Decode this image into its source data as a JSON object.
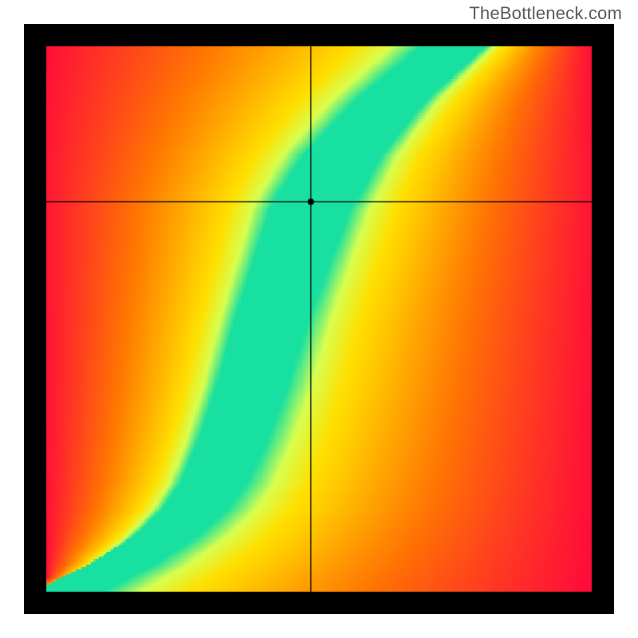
{
  "watermark": "TheBottleneck.com",
  "chart_data": {
    "type": "heatmap",
    "title": "",
    "xlabel": "",
    "ylabel": "",
    "x_range": [
      0,
      1
    ],
    "y_range": [
      0,
      1
    ],
    "crosshair": {
      "x": 0.485,
      "y": 0.715
    },
    "marker": {
      "x": 0.485,
      "y": 0.715,
      "radius": 4
    },
    "optimal_curve": {
      "description": "Green optimal-band curve through the heatmap",
      "points": [
        {
          "x": 0.0,
          "y": 0.0
        },
        {
          "x": 0.1,
          "y": 0.05
        },
        {
          "x": 0.18,
          "y": 0.1
        },
        {
          "x": 0.24,
          "y": 0.15
        },
        {
          "x": 0.28,
          "y": 0.2
        },
        {
          "x": 0.32,
          "y": 0.28
        },
        {
          "x": 0.36,
          "y": 0.38
        },
        {
          "x": 0.4,
          "y": 0.5
        },
        {
          "x": 0.44,
          "y": 0.6
        },
        {
          "x": 0.48,
          "y": 0.7
        },
        {
          "x": 0.55,
          "y": 0.8
        },
        {
          "x": 0.65,
          "y": 0.9
        },
        {
          "x": 0.78,
          "y": 1.0
        }
      ],
      "band_width": 0.045
    },
    "background_gradient": {
      "left_side": [
        "#ff003a",
        "#ff6a00",
        "#ffd400"
      ],
      "right_side": [
        "#ffd400",
        "#ff6a00",
        "#ff003a"
      ],
      "optimal_color": "#18e a9"
    },
    "frame_color": "#000000",
    "frame_thickness": 28
  }
}
